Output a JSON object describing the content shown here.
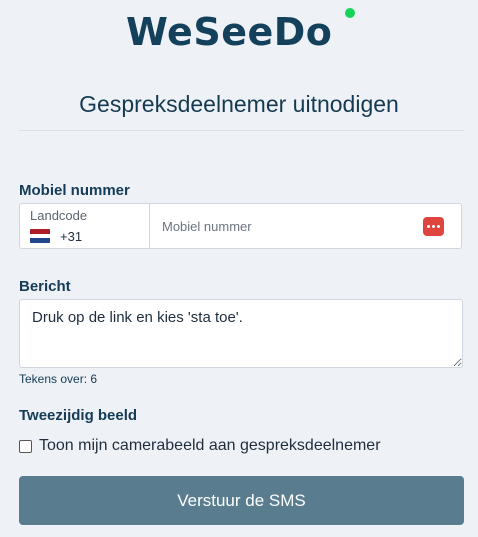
{
  "brand": {
    "logo_text": "WeSeeDo",
    "dot_color": "#16d458",
    "text_color": "#13405a"
  },
  "title": "Gespreksdeelnemer uitnodigen",
  "phone": {
    "section_label": "Mobiel nummer",
    "country_label": "Landcode",
    "country_value": "+31",
    "flag": "netherlands-flag-icon",
    "placeholder": "Mobiel nummer",
    "icon": "dots-icon",
    "icon_color": "#e0443e"
  },
  "message": {
    "section_label": "Bericht",
    "value": "Druk op de link en kies 'sta toe'.",
    "chars_left_label": "Tekens over: 6"
  },
  "two_way": {
    "section_label": "Tweezijdig beeld",
    "checkbox_label": "Toon mijn camerabeeld aan gespreksdeelnemer",
    "checked": false
  },
  "submit": {
    "label": "Verstuur de SMS",
    "color": "#597c8f"
  }
}
